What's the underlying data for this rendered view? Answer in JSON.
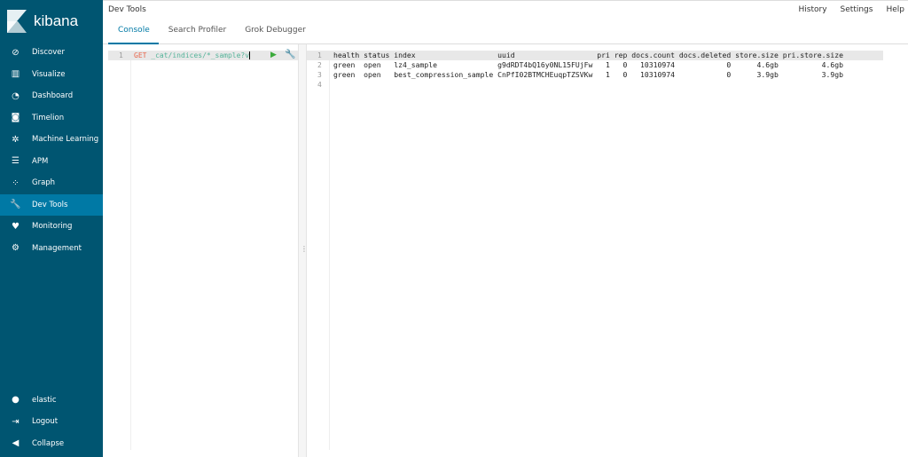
{
  "sidebar": {
    "brand": "kibana",
    "items": [
      {
        "label": "Discover",
        "icon": "compass-icon"
      },
      {
        "label": "Visualize",
        "icon": "bar-chart-icon"
      },
      {
        "label": "Dashboard",
        "icon": "dashboard-icon"
      },
      {
        "label": "Timelion",
        "icon": "timelion-icon"
      },
      {
        "label": "Machine Learning",
        "icon": "ml-icon"
      },
      {
        "label": "APM",
        "icon": "apm-icon"
      },
      {
        "label": "Graph",
        "icon": "graph-icon"
      },
      {
        "label": "Dev Tools",
        "icon": "wrench-icon",
        "active": true
      },
      {
        "label": "Monitoring",
        "icon": "heartbeat-icon"
      },
      {
        "label": "Management",
        "icon": "gear-icon"
      }
    ],
    "bottom": [
      {
        "label": "elastic",
        "icon": "user-icon"
      },
      {
        "label": "Logout",
        "icon": "logout-icon"
      },
      {
        "label": "Collapse",
        "icon": "collapse-icon"
      }
    ]
  },
  "header": {
    "title": "Dev Tools",
    "tabs": [
      "Console",
      "Search Profiler",
      "Grok Debugger"
    ],
    "links": [
      "History",
      "Settings",
      "Help"
    ]
  },
  "editor": {
    "line_number": "1",
    "method": "GET",
    "path": "_cat/indices/*_sample?v"
  },
  "output": {
    "lines": [
      "health status index                   uuid                   pri rep docs.count docs.deleted store.size pri.store.size",
      "green  open   lz4_sample              g9dRDT4bQ16y0NL15FUjFw   1   0   10310974            0      4.6gb          4.6gb",
      "green  open   best_compression_sample CnPfI02BTMCHEuqpTZSVKw   1   0   10310974            0      3.9gb          3.9gb",
      ""
    ]
  },
  "colors": {
    "sidebar": "#005571",
    "active": "#0079a5"
  }
}
